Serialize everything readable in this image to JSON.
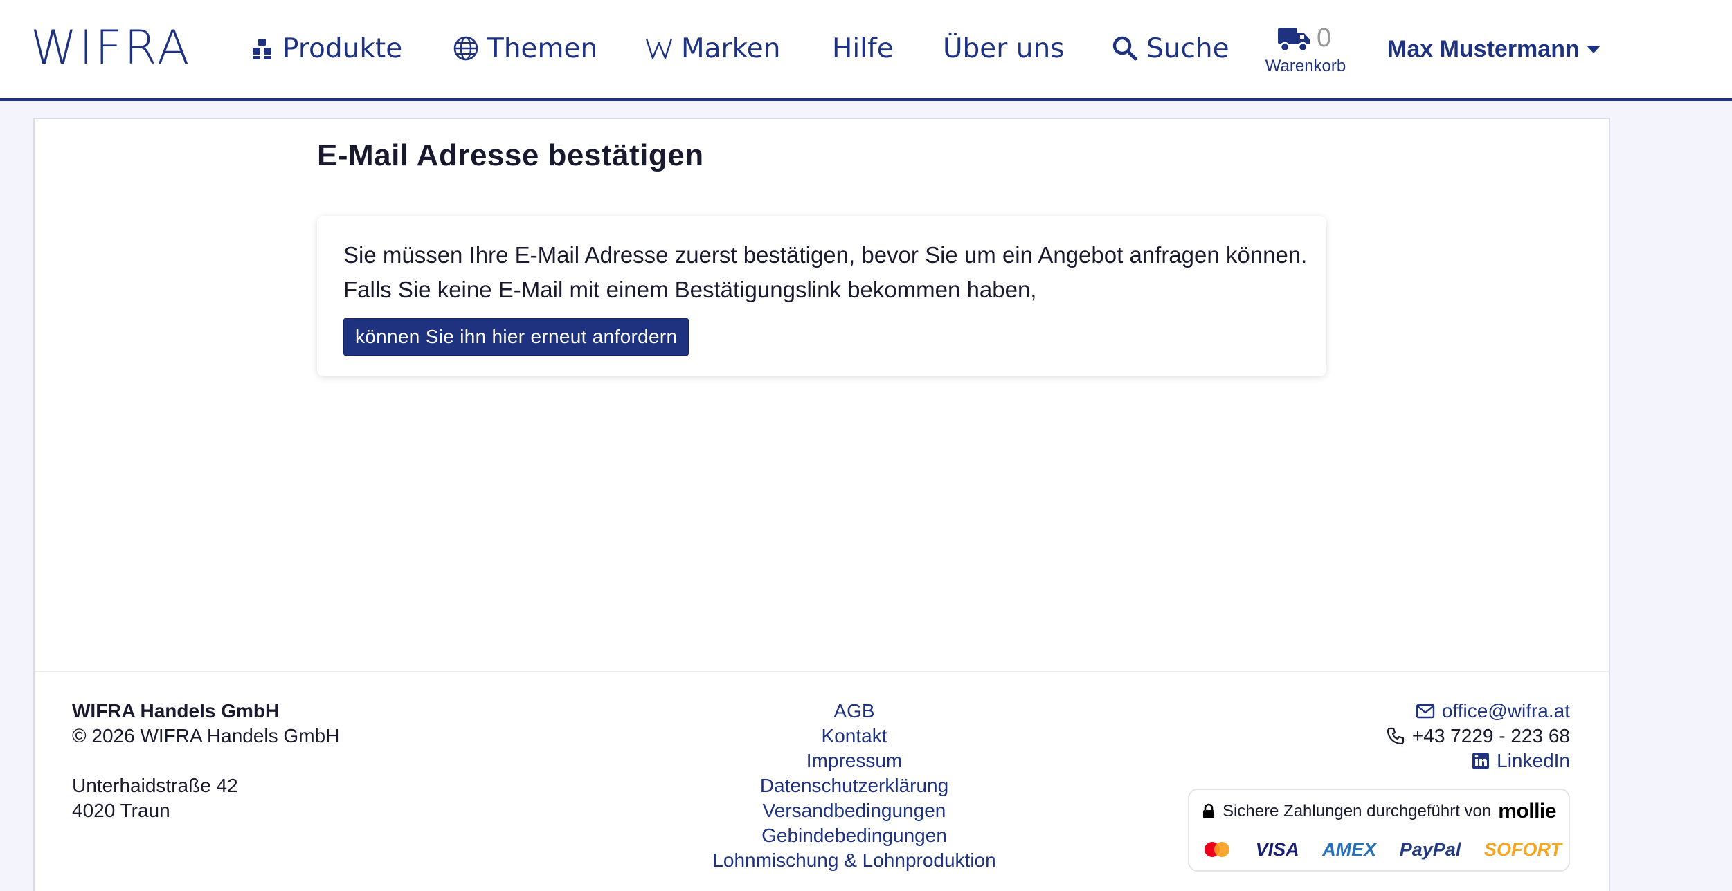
{
  "header": {
    "logo": "WIFRA",
    "nav": [
      {
        "label": "Produkte",
        "icon": "cubes-icon"
      },
      {
        "label": "Themen",
        "icon": "globe-icon"
      },
      {
        "label": "Marken",
        "icon": "w-icon"
      },
      {
        "label": "Hilfe"
      },
      {
        "label": "Über uns"
      },
      {
        "label": "Suche",
        "icon": "search-icon"
      }
    ],
    "cart": {
      "count": "0",
      "label": "Warenkorb",
      "icon": "truck-icon"
    },
    "user": {
      "name": "Max Mustermann",
      "icon": "caret-down-icon"
    }
  },
  "main": {
    "title": "E-Mail Adresse bestätigen",
    "notice_line1": "Sie müssen Ihre E-Mail Adresse zuerst bestätigen, bevor Sie um ein Angebot anfragen können.",
    "notice_line2": "Falls Sie keine E-Mail mit einem Bestätigungslink bekommen haben,",
    "resend_button": "können Sie ihn hier erneut anfordern"
  },
  "footer": {
    "company": "WIFRA Handels GmbH",
    "copyright": "© 2026 WIFRA Handels GmbH",
    "street": "Unterhaidstraße 42",
    "city": "4020 Traun",
    "links": [
      "AGB",
      "Kontakt",
      "Impressum",
      "Datenschutzerklärung",
      "Versandbedingungen",
      "Gebindebedingungen",
      "Lohnmischung & Lohnproduktion"
    ],
    "email": "office@wifra.at",
    "phone": "+43 7229 - 223 68",
    "linkedin": "LinkedIn",
    "payment": {
      "text": "Sichere Zahlungen durchgeführt von",
      "provider": "mollie",
      "methods": [
        "VISA",
        "AMEX",
        "PayPal",
        "SOFORT"
      ]
    }
  },
  "colors": {
    "primary": "#1e3280",
    "background": "#f3f4fc",
    "text": "#1a1a2e",
    "muted": "#999999",
    "mastercard_red": "#eb001b",
    "mastercard_orange": "#f79e1b",
    "sofort": "#f5a623"
  }
}
